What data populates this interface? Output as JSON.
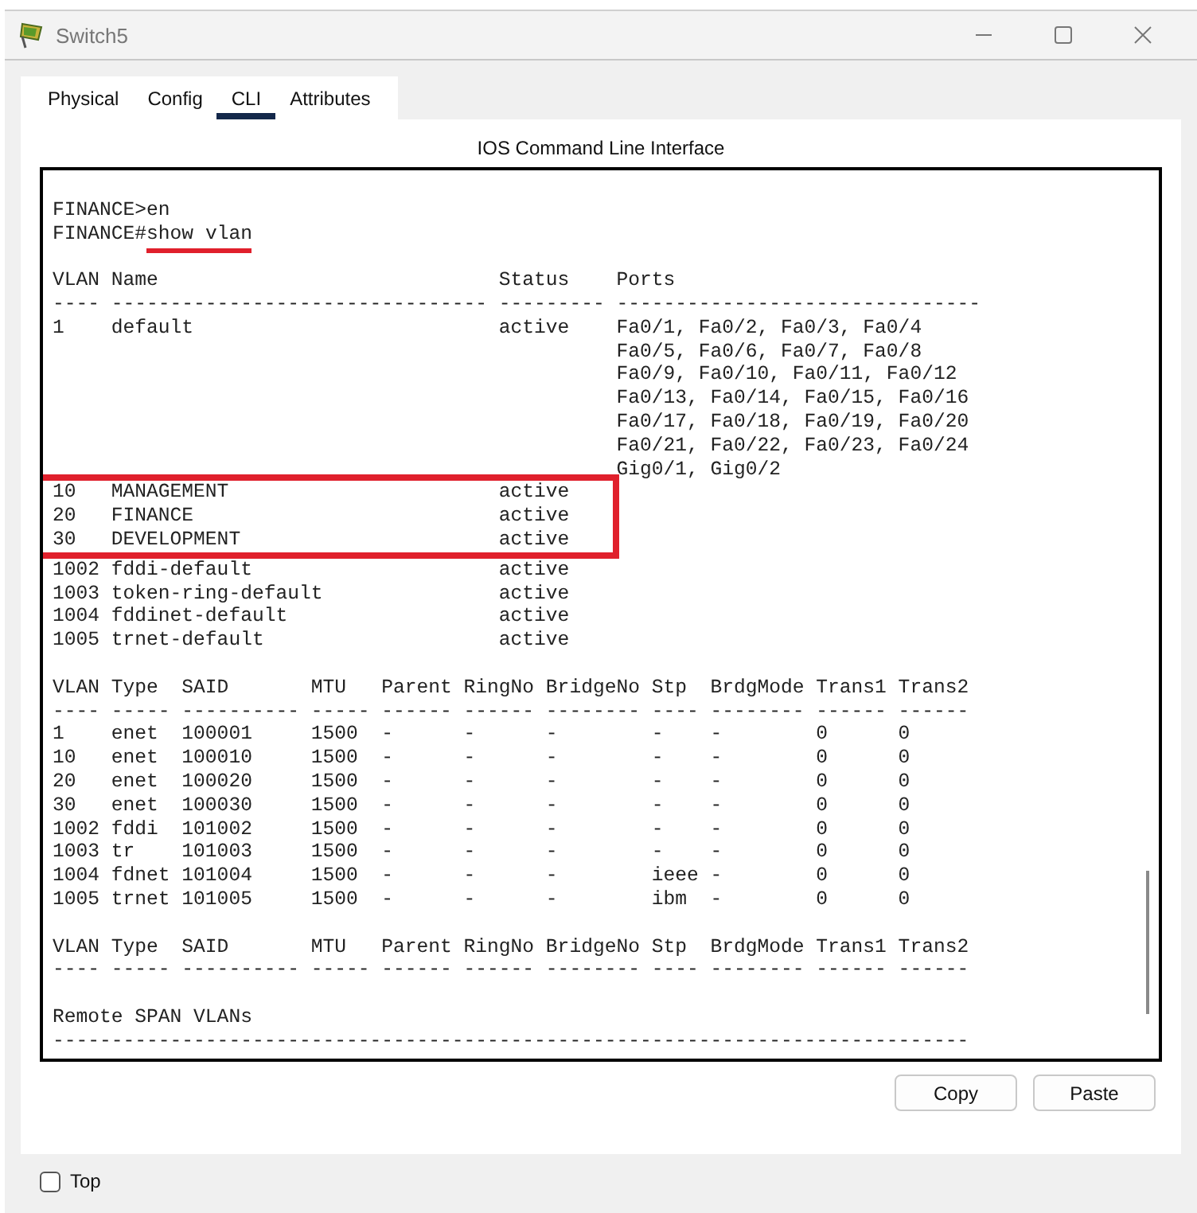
{
  "window": {
    "title": "Switch5"
  },
  "tabs": [
    {
      "label": "Physical",
      "selected": false
    },
    {
      "label": "Config",
      "selected": false
    },
    {
      "label": "CLI",
      "selected": true
    },
    {
      "label": "Attributes",
      "selected": false
    }
  ],
  "panel_title": "IOS Command Line Interface",
  "terminal": {
    "lines": [
      {
        "kind": "blank"
      },
      {
        "kind": "command",
        "prompt": "FINANCE>",
        "command": "en",
        "underlined": false,
        "boxed": false
      },
      {
        "kind": "command",
        "prompt": "FINANCE#",
        "command": "show vlan",
        "underlined": true,
        "boxed": false
      },
      {
        "kind": "blank"
      },
      {
        "kind": "output",
        "text": "VLAN Name                             Status    Ports",
        "boxed": false
      },
      {
        "kind": "output",
        "text": "---- -------------------------------- --------- -------------------------------",
        "boxed": false
      },
      {
        "kind": "output",
        "text": "1    default                          active    Fa0/1, Fa0/2, Fa0/3, Fa0/4",
        "boxed": false
      },
      {
        "kind": "output",
        "text": "                                                Fa0/5, Fa0/6, Fa0/7, Fa0/8",
        "boxed": false
      },
      {
        "kind": "output",
        "text": "                                                Fa0/9, Fa0/10, Fa0/11, Fa0/12",
        "boxed": false
      },
      {
        "kind": "output",
        "text": "                                                Fa0/13, Fa0/14, Fa0/15, Fa0/16",
        "boxed": false
      },
      {
        "kind": "output",
        "text": "                                                Fa0/17, Fa0/18, Fa0/19, Fa0/20",
        "boxed": false
      },
      {
        "kind": "output",
        "text": "                                                Fa0/21, Fa0/22, Fa0/23, Fa0/24",
        "boxed": false
      },
      {
        "kind": "output",
        "text": "                                                Gig0/1, Gig0/2",
        "boxed": false
      },
      {
        "kind": "output",
        "text": "10   MANAGEMENT                       active",
        "boxed": true
      },
      {
        "kind": "output",
        "text": "20   FINANCE                          active",
        "boxed": true
      },
      {
        "kind": "output",
        "text": "30   DEVELOPMENT                      active",
        "boxed": true
      },
      {
        "kind": "output",
        "text": "1002 fddi-default                     active",
        "boxed": false
      },
      {
        "kind": "output",
        "text": "1003 token-ring-default               active",
        "boxed": false
      },
      {
        "kind": "output",
        "text": "1004 fddinet-default                  active",
        "boxed": false
      },
      {
        "kind": "output",
        "text": "1005 trnet-default                    active",
        "boxed": false
      },
      {
        "kind": "blank"
      },
      {
        "kind": "output",
        "text": "VLAN Type  SAID       MTU   Parent RingNo BridgeNo Stp  BrdgMode Trans1 Trans2",
        "boxed": false
      },
      {
        "kind": "output",
        "text": "---- ----- ---------- ----- ------ ------ -------- ---- -------- ------ ------",
        "boxed": false
      },
      {
        "kind": "output",
        "text": "1    enet  100001     1500  -      -      -        -    -        0      0",
        "boxed": false
      },
      {
        "kind": "output",
        "text": "10   enet  100010     1500  -      -      -        -    -        0      0",
        "boxed": false
      },
      {
        "kind": "output",
        "text": "20   enet  100020     1500  -      -      -        -    -        0      0",
        "boxed": false
      },
      {
        "kind": "output",
        "text": "30   enet  100030     1500  -      -      -        -    -        0      0",
        "boxed": false
      },
      {
        "kind": "output",
        "text": "1002 fddi  101002     1500  -      -      -        -    -        0      0",
        "boxed": false
      },
      {
        "kind": "output",
        "text": "1003 tr    101003     1500  -      -      -        -    -        0      0",
        "boxed": false
      },
      {
        "kind": "output",
        "text": "1004 fdnet 101004     1500  -      -      -        ieee -        0      0",
        "boxed": false
      },
      {
        "kind": "output",
        "text": "1005 trnet 101005     1500  -      -      -        ibm  -        0      0",
        "boxed": false
      },
      {
        "kind": "blank"
      },
      {
        "kind": "output",
        "text": "VLAN Type  SAID       MTU   Parent RingNo BridgeNo Stp  BrdgMode Trans1 Trans2",
        "boxed": false
      },
      {
        "kind": "output",
        "text": "---- ----- ---------- ----- ------ ------ -------- ---- -------- ------ ------",
        "boxed": false
      },
      {
        "kind": "blank"
      },
      {
        "kind": "output",
        "text": "Remote SPAN VLANs",
        "boxed": false
      },
      {
        "kind": "output",
        "text": "------------------------------------------------------------------------------",
        "boxed": false
      }
    ]
  },
  "buttons": [
    "Copy",
    "Paste"
  ],
  "top_checkbox": {
    "label": "Top",
    "checked": false
  }
}
